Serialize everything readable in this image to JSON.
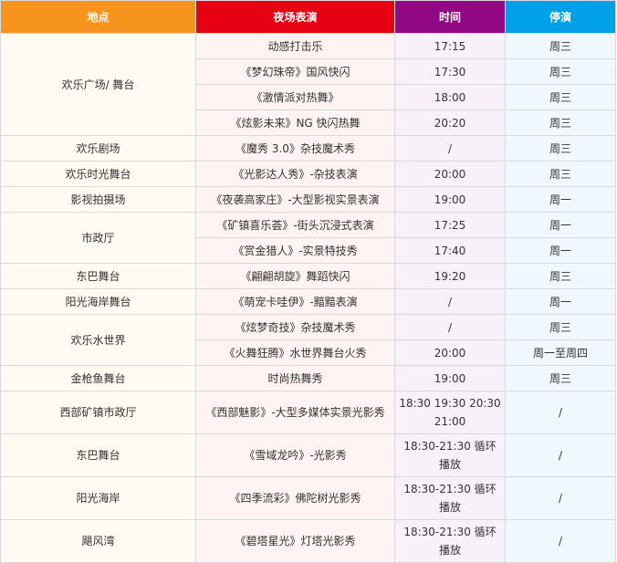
{
  "headers": {
    "location": "地点",
    "show": "夜场表演",
    "time": "时间",
    "closed": "停演"
  },
  "groups": [
    {
      "location": "欢乐广场/ 舞台",
      "rows": [
        {
          "show": "动感打击乐",
          "time": "17:15",
          "closed": "周三"
        },
        {
          "show": "《梦幻珠帝》国风快闪",
          "time": "17:30",
          "closed": "周三"
        },
        {
          "show": "《激情派对热舞》",
          "time": "18:00",
          "closed": "周三"
        },
        {
          "show": "《炫影未来》NG 快闪热舞",
          "time": "20:20",
          "closed": "周三"
        }
      ]
    },
    {
      "location": "欢乐剧场",
      "rows": [
        {
          "show": "《魔秀 3.0》杂技魔术秀",
          "time": "/",
          "closed": "周三"
        }
      ]
    },
    {
      "location": "欢乐时光舞台",
      "rows": [
        {
          "show": "《光影达人秀》-杂技表演",
          "time": "20:00",
          "closed": "周三"
        }
      ]
    },
    {
      "location": "影视拍摄场",
      "rows": [
        {
          "show": "《夜袭高家庄》-大型影视实景表演",
          "time": "19:00",
          "closed": "周一"
        }
      ]
    },
    {
      "location": "市政厅",
      "rows": [
        {
          "show": "《矿镇喜乐荟》-街头沉浸式表演",
          "time": "17:25",
          "closed": "周一"
        },
        {
          "show": "《赏金猎人》-实景特技秀",
          "time": "17:40",
          "closed": "周一"
        }
      ]
    },
    {
      "location": "东巴舞台",
      "rows": [
        {
          "show": "《翩翩胡旋》舞蹈快闪",
          "time": "19:20",
          "closed": "周三"
        }
      ]
    },
    {
      "location": "阳光海岸舞台",
      "rows": [
        {
          "show": "《萌宠卡哇伊》-黯黯表演",
          "time": "/",
          "closed": "周一"
        }
      ]
    },
    {
      "location": "欢乐水世界",
      "rows": [
        {
          "show": "《炫梦奇技》杂技魔术秀",
          "time": "/",
          "closed": "周三"
        },
        {
          "show": "《火舞狂腾》水世界舞台火秀",
          "time": "20:00",
          "closed": "周一至周四"
        }
      ]
    },
    {
      "location": "金枪鱼舞台",
      "rows": [
        {
          "show": "时尚热舞秀",
          "time": "19:00",
          "closed": "周三"
        }
      ]
    },
    {
      "location": "西部矿镇市政厅",
      "rows": [
        {
          "show": "《西部魅影》-大型多媒体实景光影秀",
          "time": "18:30 19:30 20:30 21:00",
          "closed": "/"
        }
      ]
    },
    {
      "location": "东巴舞台",
      "rows": [
        {
          "show": "《雪域龙吟》-光影秀",
          "time": "18:30-21:30 循环播放",
          "closed": "/"
        }
      ]
    },
    {
      "location": "阳光海岸",
      "rows": [
        {
          "show": "《四季流彩》佛陀树光影秀",
          "time": "18:30-21:30 循环播放",
          "closed": "/"
        }
      ]
    },
    {
      "location": "飓风湾",
      "rows": [
        {
          "show": "《碧塔星光》灯塔光影秀",
          "time": "18:30-21:30 循环播放",
          "closed": "/"
        }
      ]
    }
  ],
  "colors": {
    "header_location": "#f7941d",
    "header_show": "#e60012",
    "header_time": "#920783",
    "header_closed": "#00a0e9"
  }
}
